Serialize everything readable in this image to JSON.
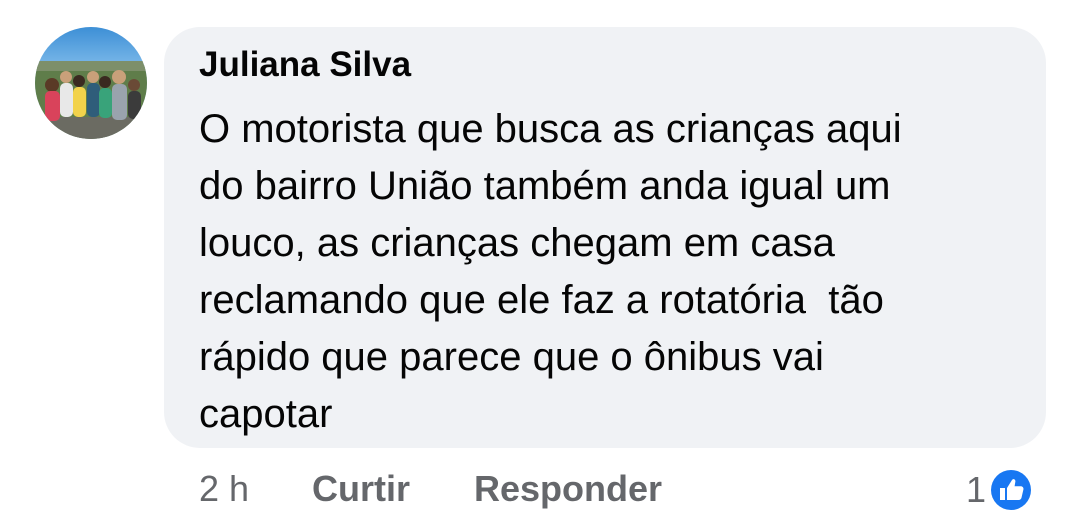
{
  "comment": {
    "author": "Juliana Silva",
    "text_lines": [
      "O motorista que busca as crianças aqui",
      "do bairro União também anda igual um",
      "louco, as crianças chegam em casa",
      "reclamando que ele faz a rotatória  tão",
      "rápido que parece que o ônibus vai",
      "capotar"
    ],
    "time": "2 h",
    "like_label": "Curtir",
    "reply_label": "Responder",
    "reaction_count": "1",
    "reaction_icon": "thumbs-up-icon"
  },
  "colors": {
    "bubble": "#f0f2f5",
    "text": "#050505",
    "secondary": "#65676b",
    "like_blue": "#1877f2"
  }
}
